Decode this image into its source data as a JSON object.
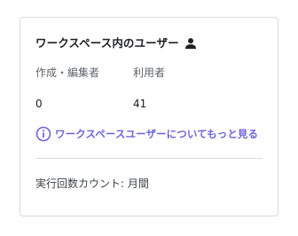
{
  "card": {
    "title": "ワークスペース内のユーザー",
    "title_icon": "person-icon",
    "columns": [
      {
        "label": "作成・編集者",
        "value": "0"
      },
      {
        "label": "利用者",
        "value": "41"
      }
    ],
    "link": {
      "icon": "info-icon",
      "label": "ワークスペースユーザーについてもっと見る",
      "color": "#6c63d8"
    },
    "footer": "実行回数カウント: 月間"
  }
}
